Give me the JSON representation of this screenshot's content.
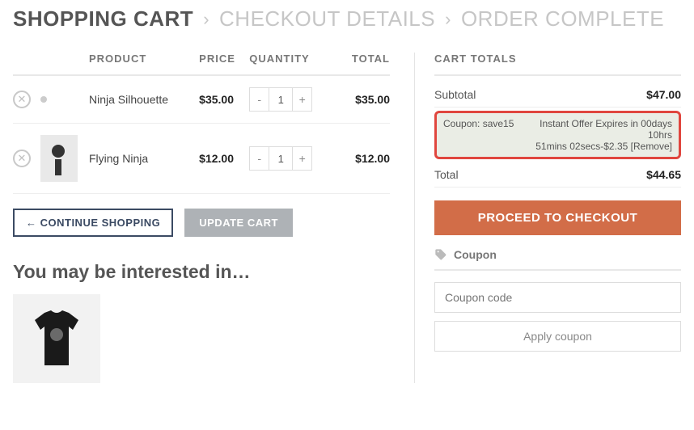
{
  "breadcrumb": {
    "step1": "SHOPPING CART",
    "step2": "CHECKOUT DETAILS",
    "step3": "ORDER COMPLETE"
  },
  "headers": {
    "product": "PRODUCT",
    "price": "PRICE",
    "quantity": "QUANTITY",
    "total": "TOTAL"
  },
  "items": [
    {
      "name": "Ninja Silhouette",
      "price": "$35.00",
      "qty": "1",
      "total": "$35.00"
    },
    {
      "name": "Flying Ninja",
      "price": "$12.00",
      "qty": "1",
      "total": "$12.00"
    }
  ],
  "actions": {
    "continue": "← CONTINUE SHOPPING",
    "update": "UPDATE CART"
  },
  "interest_heading": "You may be interested in…",
  "cart_totals": {
    "heading": "CART TOTALS",
    "subtotal_label": "Subtotal",
    "subtotal": "$47.00",
    "coupon_label": "Coupon: save15",
    "coupon_msg_l1": "Instant Offer Expires in 00days 10hrs",
    "coupon_msg_l2_prefix": "51mins 02secs",
    "coupon_discount": "-$2.35",
    "coupon_remove": "[Remove]",
    "total_label": "Total",
    "total": "$44.65"
  },
  "checkout_btn": "PROCEED TO CHECKOUT",
  "coupon_section": {
    "label": "Coupon",
    "placeholder": "Coupon code",
    "apply": "Apply coupon"
  }
}
